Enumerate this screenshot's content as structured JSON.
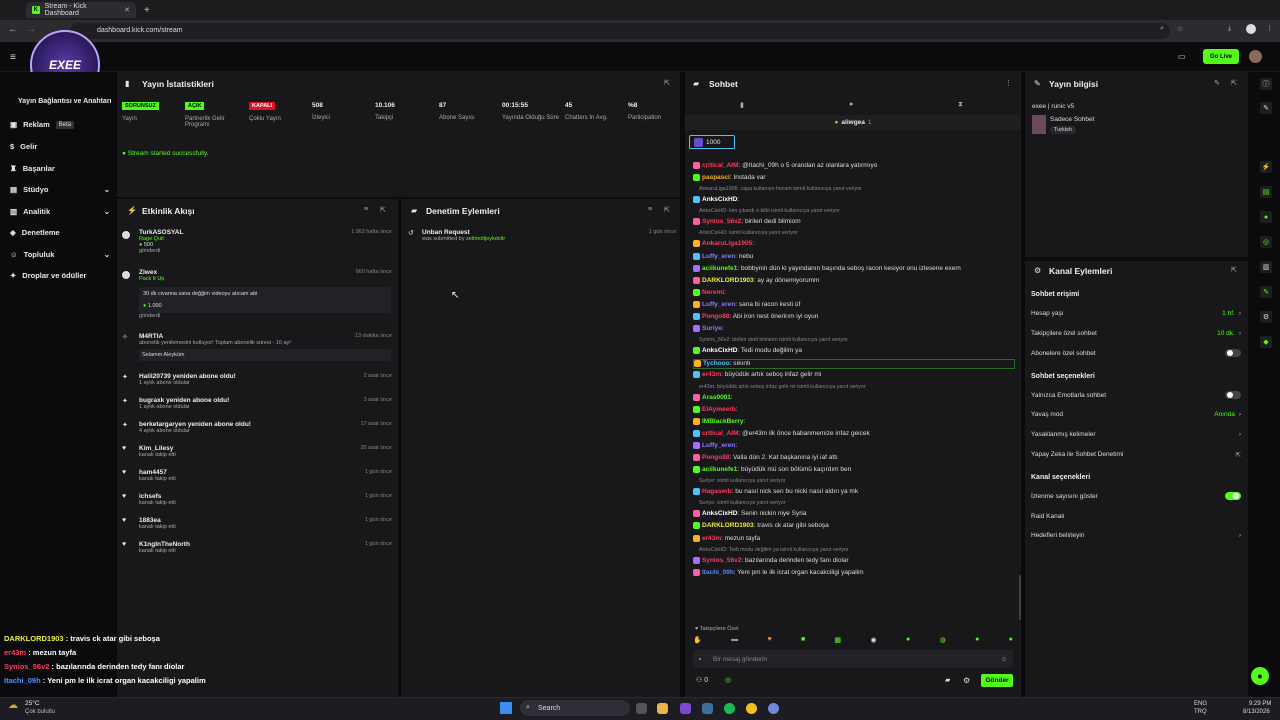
{
  "browser": {
    "tab_title": "Stream - Kick Dashboard",
    "url": "dashboard.kick.com/stream",
    "new_tab": "+"
  },
  "header": {
    "go_live": "Go Live",
    "avatar_text": "EXEE"
  },
  "sidebar": {
    "items": [
      {
        "label": "Yayın Bağlantısı ve Anahtarı"
      },
      {
        "label": "Reklam",
        "badge": "Beta"
      },
      {
        "label": "Gelir"
      },
      {
        "label": "Başarılar"
      },
      {
        "label": "Stüdyo"
      },
      {
        "label": "Analitik"
      },
      {
        "label": "Denetleme"
      },
      {
        "label": "Topluluk"
      },
      {
        "label": "Droplar ve ödüller"
      }
    ]
  },
  "stats": {
    "title": "Yayın İstatistikleri",
    "cells": [
      {
        "badge": "SORUNSUZ",
        "label": "Yayın"
      },
      {
        "badge": "AÇIK",
        "label": "Partnerlik Gelir Programı"
      },
      {
        "badge": "KAPALI",
        "label": "Çoklu Yayın"
      },
      {
        "value": "508",
        "label": "İzleyici"
      },
      {
        "value": "10.106",
        "label": "Takipçi"
      },
      {
        "value": "87",
        "label": "Abone Sayısı"
      },
      {
        "value": "00:15:55",
        "label": "Yayında Olduğu Süre"
      },
      {
        "value": "45",
        "label": "Chatters In Avg."
      },
      {
        "value": "%8",
        "label": "Participation"
      }
    ],
    "status_msg": "Stream started successfully."
  },
  "activity": {
    "title": "Etkinlik Akışı",
    "items": [
      {
        "name": "TurkASOSYAL",
        "sub": "Rage Quit",
        "amount": "500",
        "note": "gönderdi",
        "time": "1.962 hafta önce"
      },
      {
        "name": "Ziwex",
        "sub": "Pack It Up",
        "msg": "30 dk civanna sana değğim videoyu atıcam abi",
        "amount": "1.000",
        "note": "gönderdi",
        "time": "969 hafta önce"
      },
      {
        "name": "M4RTIA",
        "sub": "abonelik yenilemesini kutluyor! Toplam abonelik süresi - 10 ay!",
        "msg": "Selamm Aleyküm",
        "time": "13 dakika önce"
      },
      {
        "name": "Halil20739 yeniden abone oldu!",
        "sub": "1 aylık abone oldular",
        "time": "2 saat önce"
      },
      {
        "name": "bugraxk yeniden abone oldu!",
        "sub": "1 aylık abone oldular",
        "time": "3 saat önce"
      },
      {
        "name": "berketargaryen yeniden abone oldu!",
        "sub": "4 aylık abone oldular",
        "time": "17 saat önce"
      },
      {
        "name": "Kim_Lilesy",
        "sub": "kanalı takip etti",
        "time": "20 saat önce"
      },
      {
        "name": "ham4457",
        "sub": "kanalı takip etti",
        "time": "1 gün önce"
      },
      {
        "name": "ichsefs",
        "sub": "kanalı takip etti",
        "time": "1 gün önce"
      },
      {
        "name": "1883ea",
        "sub": "kanalı takip etti",
        "time": "1 gün önce"
      },
      {
        "name": "K1ngInTheNorth",
        "sub": "kanalı takip etti",
        "time": "1 gün önce"
      }
    ]
  },
  "moderation": {
    "title": "Denetim Eylemleri",
    "item_title": "Unban Request",
    "item_sub": "was submitted by",
    "item_user": "zeitmoltjeykdsltr",
    "item_time": "1 gün önce"
  },
  "chat": {
    "title": "Sohbet",
    "pinned_user": "aliwgea",
    "pinned_count": "1",
    "goal_value": "1000",
    "lines": [
      {
        "user": "critical_AIM",
        "color": "#ff3b5c",
        "text": ": @Itachi_09h o 5 orandan az olanlara yatırmıyo"
      },
      {
        "user": "paspasci",
        "color": "#ffb020",
        "text": ": Instada var"
      },
      {
        "sys": "AnkaruLiga1905: capa kullanıyo hocam isimli kullanıcıya yanıt veriyor"
      },
      {
        "user": "AnksCixHD",
        "color": "#ffffff",
        "text": ":"
      },
      {
        "sys": "AnksCixHD: kim çıkardı o klibi isimli kullanıcıya yanıt veriyor"
      },
      {
        "user": "Synios_56v2",
        "color": "#ff3b5c",
        "text": ": birileri dedi bilmiom"
      },
      {
        "sys": "AnksCixHD: isimli kullanıcıya yanıt veriyor"
      },
      {
        "user": "AnkaruLiga1905",
        "color": "#ff3b5c",
        "text": ":"
      },
      {
        "user": "Luffy_eren",
        "color": "#8c7cff",
        "text": ": nebu"
      },
      {
        "user": "aciikunefe1",
        "color": "#53fc18",
        "text": ": bobbynin dün ki yayındanın başında seboş racon kesiyor onu izlesene exem"
      },
      {
        "user": "DARKLORD1903",
        "color": "#e8f040",
        "text": ": ay ay dönemiyorumm"
      },
      {
        "user": "Neremi",
        "color": "#ff3b5c",
        "text": ":"
      },
      {
        "user": "Luffy_eren",
        "color": "#8c7cff",
        "text": ": sana bi racon kesti üf"
      },
      {
        "user": "Pongo88",
        "color": "#ff3b5c",
        "text": ": Abi iron nest önerirım iyi oyun"
      },
      {
        "user": "Suriye",
        "color": "#a86cff",
        "text": ":"
      },
      {
        "sys": "Synios_56v2: birileri dedi bilmiom isimli kullanıcıya yanıt veriyor"
      },
      {
        "user": "AnksCixHD",
        "color": "#ffffff",
        "text": ": Tedi modu değilim ya"
      },
      {
        "user": "Tychooo",
        "color": "#4fc3f7",
        "text": ": sıkıntı"
      },
      {
        "user": "er43m",
        "color": "#ff3b5c",
        "text": ": büyüdük artık seboş infaz gelir mi"
      },
      {
        "sys": "er43m: büyüdük artık seboş infaz gelir mi isimli kullanıcıya yanıt veriyor"
      },
      {
        "user": "Aras0001",
        "color": "#53fc18",
        "text": ":"
      },
      {
        "user": "ElAymeerb",
        "color": "#ff3b5c",
        "text": ":"
      },
      {
        "user": "IMBlackBerry",
        "color": "#53fc18",
        "text": ":"
      },
      {
        "user": "critical_AIM",
        "color": "#ff3b5c",
        "text": ": @er43m ilk önce babanmemize infaz geicek"
      },
      {
        "user": "Luffy_eren",
        "color": "#8c7cff",
        "text": ":"
      },
      {
        "user": "Pongo88",
        "color": "#ff3b5c",
        "text": ": Valla dün 2. Kat başkanına iyi iaf attı"
      },
      {
        "user": "aciikunefe1",
        "color": "#53fc18",
        "text": ": büyüdük mü son bölümü kaçırdım ben"
      },
      {
        "sys": "Suriye: isimli kullanıcıya yanıt veriyor"
      },
      {
        "user": "Hagaserb",
        "color": "#ff3b5c",
        "text": ": bu nasıl nick sen bu nicki nasıl aldın ya mk"
      },
      {
        "sys": "Suriye: isimli kullanıcıya yanıt veriyor"
      },
      {
        "user": "AnksCixHD",
        "color": "#ffffff",
        "text": ": Senin nickin niye Syria"
      },
      {
        "user": "DARKLORD1903",
        "color": "#e8f040",
        "text": ": travis ck atar gibi seboşa"
      },
      {
        "user": "er43m",
        "color": "#ff3b5c",
        "text": ": mezun tayfa"
      },
      {
        "sys": "AnksCixHD: Tedi modu değilim ya isimli kullanıcıya yanıt veriyor"
      },
      {
        "user": "Synios_56v2",
        "color": "#ff3b5c",
        "text": ": bazılarında derinden tedy fanı diolar"
      },
      {
        "user": "Itachi_09h",
        "color": "#4f8cff",
        "text": ": Yeni pm le ilk icrat organ kacakciligi yapalim"
      }
    ],
    "followers_only": "Takipçilere Özel",
    "input_placeholder": "Bir mesaj gönderin",
    "points": "0",
    "send": "Gönder"
  },
  "stream_info": {
    "title": "Yayın bilgisi",
    "stream_title": "exee | runic v5",
    "category": "Sadece Sohbet",
    "tag": "Turkish"
  },
  "channel_actions": {
    "title": "Kanal Eylemleri",
    "section1": "Sohbet erişimi",
    "rows1": [
      {
        "label": "Hesap yaşı",
        "value": "1 hf."
      },
      {
        "label": "Takipçilere özel sohbet",
        "value": "10 dk."
      },
      {
        "label": "Abonelere özel sohbet",
        "toggle": false
      }
    ],
    "section2": "Sohbet seçenekleri",
    "rows2": [
      {
        "label": "Yalnızca Emotlarla sohbet",
        "toggle": false
      },
      {
        "label": "Yavaş mod",
        "value": "Anında"
      },
      {
        "label": "Yasaklanmış kelimeler"
      },
      {
        "label": "Yapay Zeka ile Sohbet Denetimi"
      }
    ],
    "section3": "Kanal seçenekleri",
    "rows3": [
      {
        "label": "İzlenme sayısını göster",
        "toggle": true
      },
      {
        "label": "Raid Kanalı"
      },
      {
        "label": "Hedefleri belirleyin"
      }
    ]
  },
  "overlay": {
    "lines": [
      {
        "user": "DARKLORD1903",
        "color": "#e8f040",
        "text": " : travis ck atar gibi seboşa"
      },
      {
        "user": "er43m",
        "color": "#ff3b5c",
        "text": " : mezun tayfa"
      },
      {
        "user": "Synios_56v2",
        "color": "#ff3b5c",
        "text": " : bazılarında derinden tedy fanı diolar"
      },
      {
        "user": "Itachi_09h",
        "color": "#4f8cff",
        "text": " : Yeni pm le ilk icrat organ kacakciligi yapalim"
      }
    ]
  },
  "taskbar": {
    "weather_temp": "25°C",
    "weather_desc": "Çok bulutlu",
    "search": "Search",
    "lang": "ENG",
    "region": "TRQ",
    "time": "9:29 PM",
    "date": "8/13/2026"
  }
}
